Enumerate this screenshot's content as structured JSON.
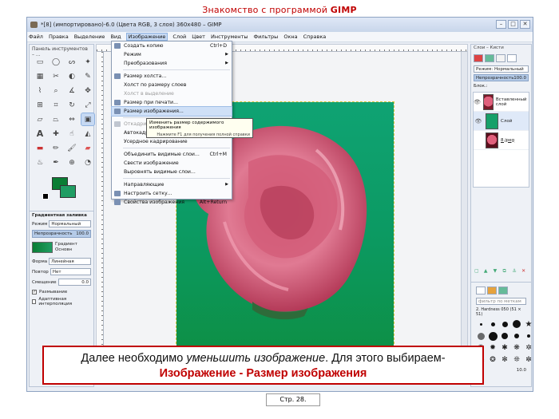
{
  "slide": {
    "title_regular": "Знакомство с программой ",
    "title_bold": "GIMP",
    "caption_line1_regular": "Далее необходимо ",
    "caption_line1_italic": "уменьшить изображение",
    "caption_line1_end": ". Для этого выбираем-",
    "caption_line2": "Изображение - Размер изображения",
    "page_label": "Стр. 28."
  },
  "window": {
    "title": "*[8] (импортировано)-6.0 (Цвета RGB, 3 слоя) 360x480 – GIMP",
    "controls": [
      "–",
      "□",
      "✕"
    ]
  },
  "menubar": [
    "Файл",
    "Правка",
    "Выделение",
    "Вид",
    "Изображение",
    "Слой",
    "Цвет",
    "Инструменты",
    "Фильтры",
    "Окна",
    "Справка"
  ],
  "toolbox": {
    "title": "Панель инструментов – ...",
    "tool_icons": [
      "rect-select",
      "ellipse-select",
      "free-select",
      "fuzzy-select",
      "color-select",
      "scissors",
      "foreground-select",
      "paths",
      "color-picker",
      "zoom",
      "measure",
      "move",
      "align",
      "crop",
      "rotate",
      "scale",
      "shear",
      "perspective",
      "flip",
      "cage",
      "text",
      "heal",
      "smudge",
      "bucket-fill",
      "blend",
      "pencil",
      "paintbrush",
      "eraser",
      "airbrush",
      "ink",
      "clone",
      "dodge"
    ],
    "options": {
      "title": "Градиентная заливка",
      "mode_label": "Режим",
      "mode_value": "Нормальный",
      "opacity_label": "Непрозрачность",
      "opacity_value": "100.0",
      "gradient_label": "Градиент",
      "gradient_sub": "Основн",
      "shape_label": "Форма",
      "shape_value": "Линейная",
      "repeat_label": "Повтор",
      "repeat_value": "Нет",
      "offset_label": "Смещение",
      "offset_value": "0.0",
      "dither_label": "Размывание",
      "adaptive_label": "Адаптивная интерполяция"
    }
  },
  "image_menu": {
    "items": [
      {
        "label": "Создать копию",
        "accel": "Ctrl+D",
        "disabled": false,
        "icon": true
      },
      {
        "label": "Режим",
        "arrow": true
      },
      {
        "label": "Преобразования",
        "arrow": true
      },
      {
        "sep": true
      },
      {
        "label": "Размер холста...",
        "icon": true
      },
      {
        "label": "Холст по размеру слоев"
      },
      {
        "label": "Холст в выделение",
        "disabled": true
      },
      {
        "label": "Размер при печати...",
        "icon": true
      },
      {
        "label": "Размер изображения...",
        "icon": true,
        "highlight": true
      },
      {
        "sep": true
      },
      {
        "label": "Откадрировать...",
        "disabled": true,
        "icon": true
      },
      {
        "label": "Автокадрирование"
      },
      {
        "label": "Усердное кадрирование"
      },
      {
        "sep": true
      },
      {
        "label": "Объединить видимые слои...",
        "accel": "Ctrl+M"
      },
      {
        "label": "Свести изображение"
      },
      {
        "label": "Выровнять видимые слои..."
      },
      {
        "sep": true
      },
      {
        "label": "Направляющие",
        "arrow": true
      },
      {
        "label": "Настроить сетку...",
        "icon": true
      },
      {
        "label": "Свойства изображения",
        "accel": "Alt+Return",
        "icon": true
      }
    ],
    "tooltip": "Изменить размер содержимого изображения",
    "tooltip_hint": "Нажмите F1 для получения полной справки"
  },
  "layers_panel": {
    "title": "Слои – Кисти",
    "mode_value": "Режим: Нормальный",
    "opacity_label": "Непрозрачность",
    "opacity_value": "100.0",
    "lock_label": "Блок.:",
    "layers": [
      {
        "name": "Вставленный слой",
        "thumb": "rose",
        "eye": true
      },
      {
        "name": "Слой",
        "thumb": "green",
        "eye": true,
        "selected": true
      },
      {
        "name": "8.jpeg",
        "thumb": "rose2",
        "eye": false
      }
    ],
    "brush_filter": "фильтр по меткам",
    "brush_name": "2. Hardness 050 (51 × 51)",
    "brush_spacing": "10.0"
  },
  "colors": {
    "fg": "#0a7d34",
    "bg": "#1f9d63",
    "accent": "#c00000"
  }
}
